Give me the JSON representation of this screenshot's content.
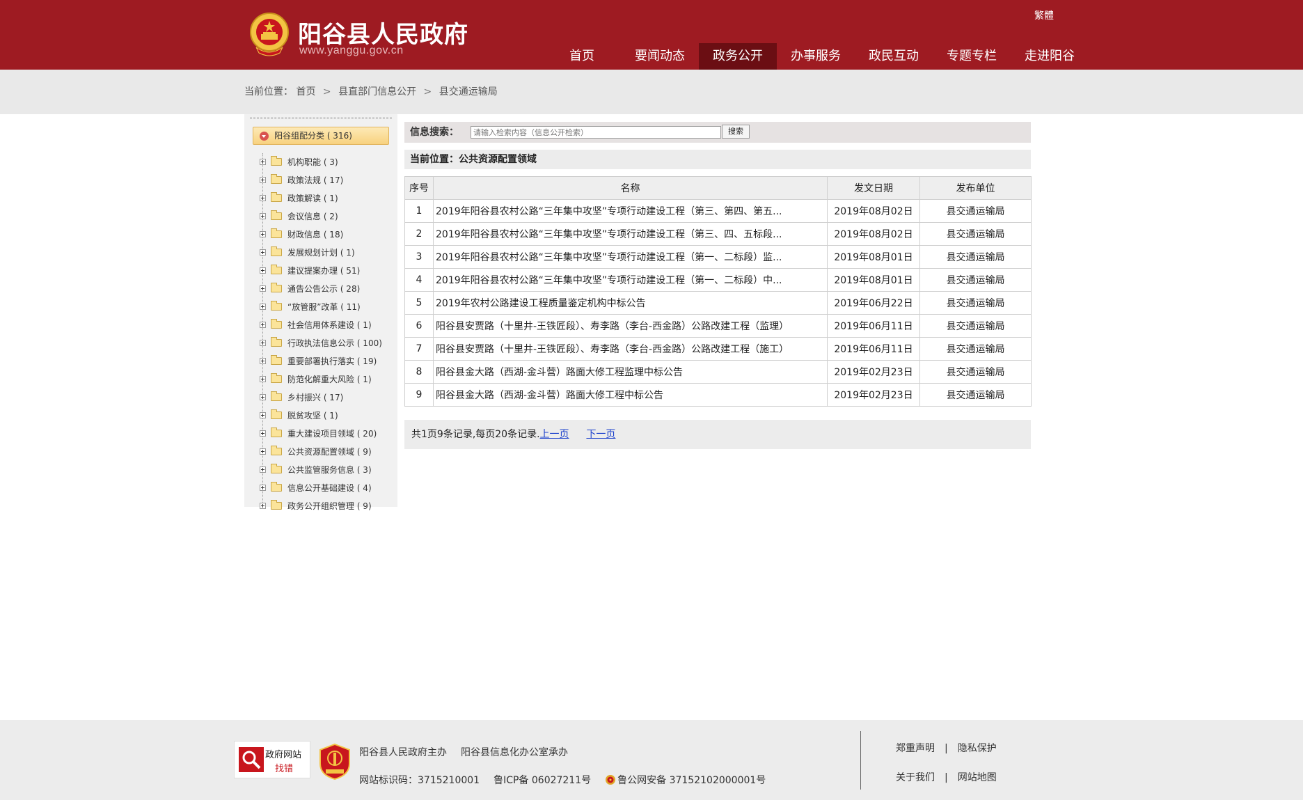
{
  "header": {
    "site_name": "阳谷县人民政府",
    "site_url": "www.yanggu.gov.cn",
    "traditional_label": "繁體",
    "nav": [
      {
        "label": "首页",
        "active": false
      },
      {
        "label": "要闻动态",
        "active": false
      },
      {
        "label": "政务公开",
        "active": true
      },
      {
        "label": "办事服务",
        "active": false
      },
      {
        "label": "政民互动",
        "active": false
      },
      {
        "label": "专题专栏",
        "active": false
      },
      {
        "label": "走进阳谷",
        "active": false
      }
    ],
    "colors": {
      "brand": "#9e1b22",
      "nav_active": "#6b0e13"
    }
  },
  "breadcrumb": {
    "prefix": "当前位置：",
    "items": [
      "首页",
      "县直部门信息公开",
      "县交通运输局"
    ],
    "separator": ">"
  },
  "sidebar": {
    "root": "阳谷组配分类 ( 316)",
    "items": [
      "机构职能 ( 3)",
      "政策法规 ( 17)",
      "政策解读 ( 1)",
      "会议信息 ( 2)",
      "财政信息 ( 18)",
      "发展规划计划 ( 1)",
      "建议提案办理 ( 51)",
      "通告公告公示 ( 28)",
      "“放管服”改革 ( 11)",
      "社会信用体系建设 ( 1)",
      "行政执法信息公示 ( 100)",
      "重要部署执行落实 ( 19)",
      "防范化解重大风险 ( 1)",
      "乡村振兴 ( 17)",
      "脱贫攻坚 ( 1)",
      "重大建设项目领域 ( 20)",
      "公共资源配置领域 ( 9)",
      "公共监管服务信息 ( 3)",
      "信息公开基础建设 ( 4)",
      "政务公开组织管理 ( 9)"
    ]
  },
  "search": {
    "label": "信息搜索：",
    "placeholder": "请输入检索内容（信息公开检索）",
    "button": "搜索"
  },
  "current_section": "当前位置：公共资源配置领域",
  "table": {
    "headers": [
      "序号",
      "名称",
      "发文日期",
      "发布单位"
    ],
    "rows": [
      {
        "idx": "1",
        "name": "2019年阳谷县农村公路“三年集中攻坚”专项行动建设工程（第三、第四、第五...",
        "date": "2019年08月02日",
        "unit": "县交通运输局"
      },
      {
        "idx": "2",
        "name": "2019年阳谷县农村公路“三年集中攻坚”专项行动建设工程（第三、四、五标段...",
        "date": "2019年08月02日",
        "unit": "县交通运输局"
      },
      {
        "idx": "3",
        "name": "2019年阳谷县农村公路“三年集中攻坚”专项行动建设工程（第一、二标段）监...",
        "date": "2019年08月01日",
        "unit": "县交通运输局"
      },
      {
        "idx": "4",
        "name": "2019年阳谷县农村公路“三年集中攻坚”专项行动建设工程（第一、二标段）中...",
        "date": "2019年08月01日",
        "unit": "县交通运输局"
      },
      {
        "idx": "5",
        "name": "2019年农村公路建设工程质量鉴定机构中标公告",
        "date": "2019年06月22日",
        "unit": "县交通运输局"
      },
      {
        "idx": "6",
        "name": "阳谷县安贾路（十里井-王铁匠段）、寿李路（李台-西金路）公路改建工程（监理）",
        "date": "2019年06月11日",
        "unit": "县交通运输局"
      },
      {
        "idx": "7",
        "name": "阳谷县安贾路（十里井-王铁匠段）、寿李路（李台-西金路）公路改建工程（施工）",
        "date": "2019年06月11日",
        "unit": "县交通运输局"
      },
      {
        "idx": "8",
        "name": "阳谷县金大路（西湖-金斗营）路面大修工程监理中标公告",
        "date": "2019年02月23日",
        "unit": "县交通运输局"
      },
      {
        "idx": "9",
        "name": "阳谷县金大路（西湖-金斗营）路面大修工程中标公告",
        "date": "2019年02月23日",
        "unit": "县交通运输局"
      }
    ]
  },
  "pager": {
    "summary": "共1页9条记录,每页20条记录.",
    "prev": "上一页",
    "next": "下一页"
  },
  "footer": {
    "badge_line1": "政府网站",
    "badge_line2": "找错",
    "badge2_text": "党政机关",
    "sponsor": "阳谷县人民政府主办",
    "organizer": "阳谷县信息化办公室承办",
    "site_id": "网站标识码：3715210001",
    "icp": "鲁ICP备 06027211号",
    "police": "鲁公网安备 37152102000001号",
    "links_row1": [
      "郑重声明",
      "隐私保护"
    ],
    "links_row2": [
      "关于我们",
      "网站地图"
    ]
  }
}
